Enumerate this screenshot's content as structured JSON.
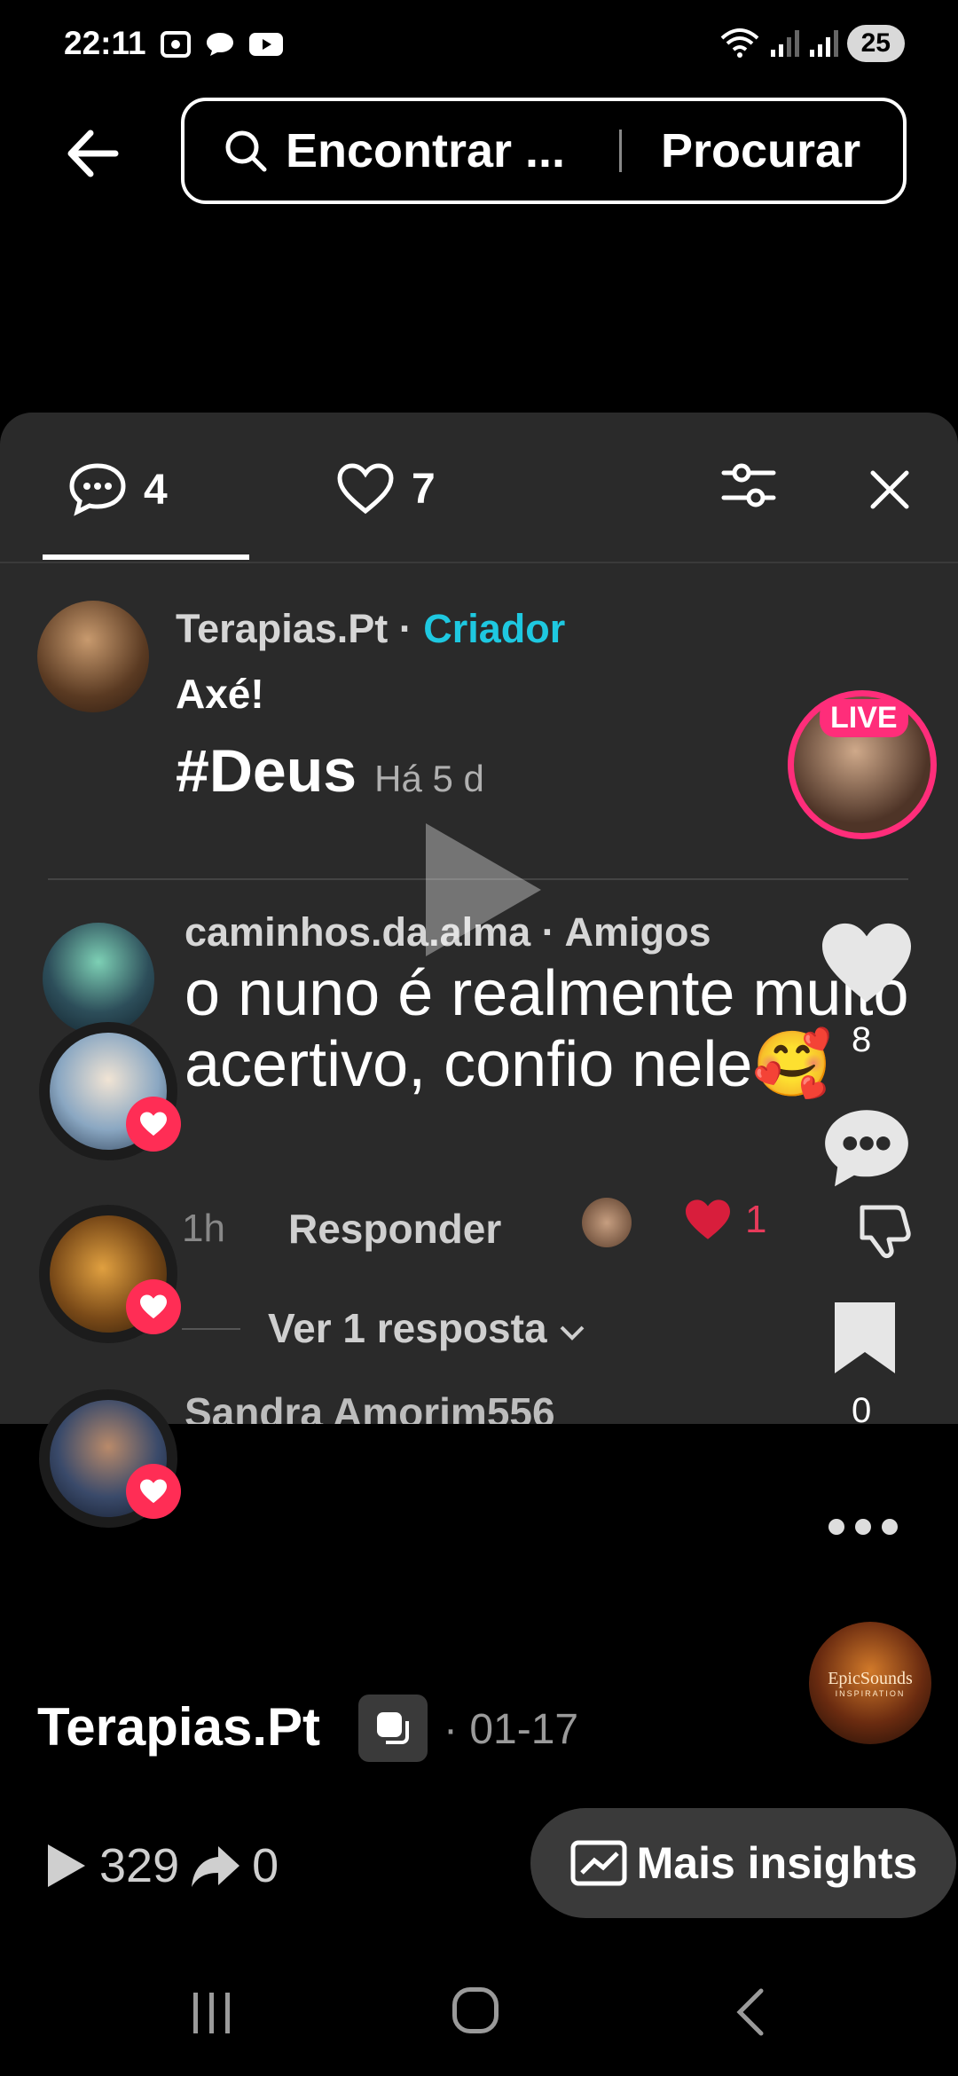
{
  "status": {
    "time": "22:11",
    "battery": "25"
  },
  "search": {
    "placeholder": "Encontrar ...",
    "button": "Procurar"
  },
  "sheet": {
    "tabs": [
      {
        "count": "4",
        "icon": "comment-icon"
      },
      {
        "count": "7",
        "icon": "heart-icon"
      }
    ]
  },
  "comments": [
    {
      "author": "Terapias.Pt",
      "badge": "Criador",
      "line1": "Axé!",
      "line2": "#Deus",
      "time": "Há 5 d"
    },
    {
      "author": "caminhos.da.alma",
      "badge": "Amigos",
      "text": "o nuno é realmente muito acertivo, confio nele🥰",
      "time": "1h",
      "reply": "Responder",
      "likes": "1",
      "view_replies": "Ver 1 resposta"
    }
  ],
  "peek_author": "Sandra Amorim556",
  "rail": {
    "live": "LIVE",
    "likes": "8",
    "saves": "0"
  },
  "music": {
    "title": "EpicSounds",
    "subtitle": "INSPIRATION"
  },
  "post": {
    "author": "Terapias.Pt",
    "date": "· 01-17",
    "plays": "329",
    "shares": "0",
    "insights": "Mais insights"
  }
}
